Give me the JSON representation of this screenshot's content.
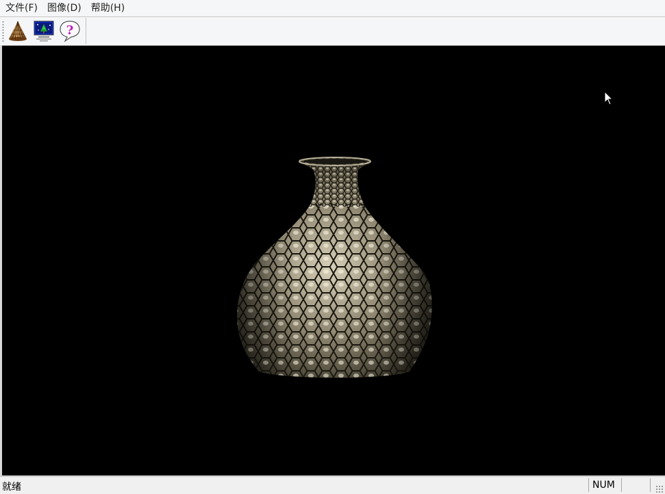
{
  "menubar": {
    "items": [
      {
        "label": "文件(F)"
      },
      {
        "label": "图像(D)"
      },
      {
        "label": "帮助(H)"
      }
    ]
  },
  "toolbar": {
    "buttons": [
      {
        "icon": "cone-model-icon"
      },
      {
        "icon": "display-scene-icon"
      },
      {
        "icon": "help-balloon-icon"
      }
    ]
  },
  "viewport": {
    "background": "#000000",
    "object": "vase"
  },
  "statusbar": {
    "text": "就绪",
    "num_indicator": "NUM"
  }
}
